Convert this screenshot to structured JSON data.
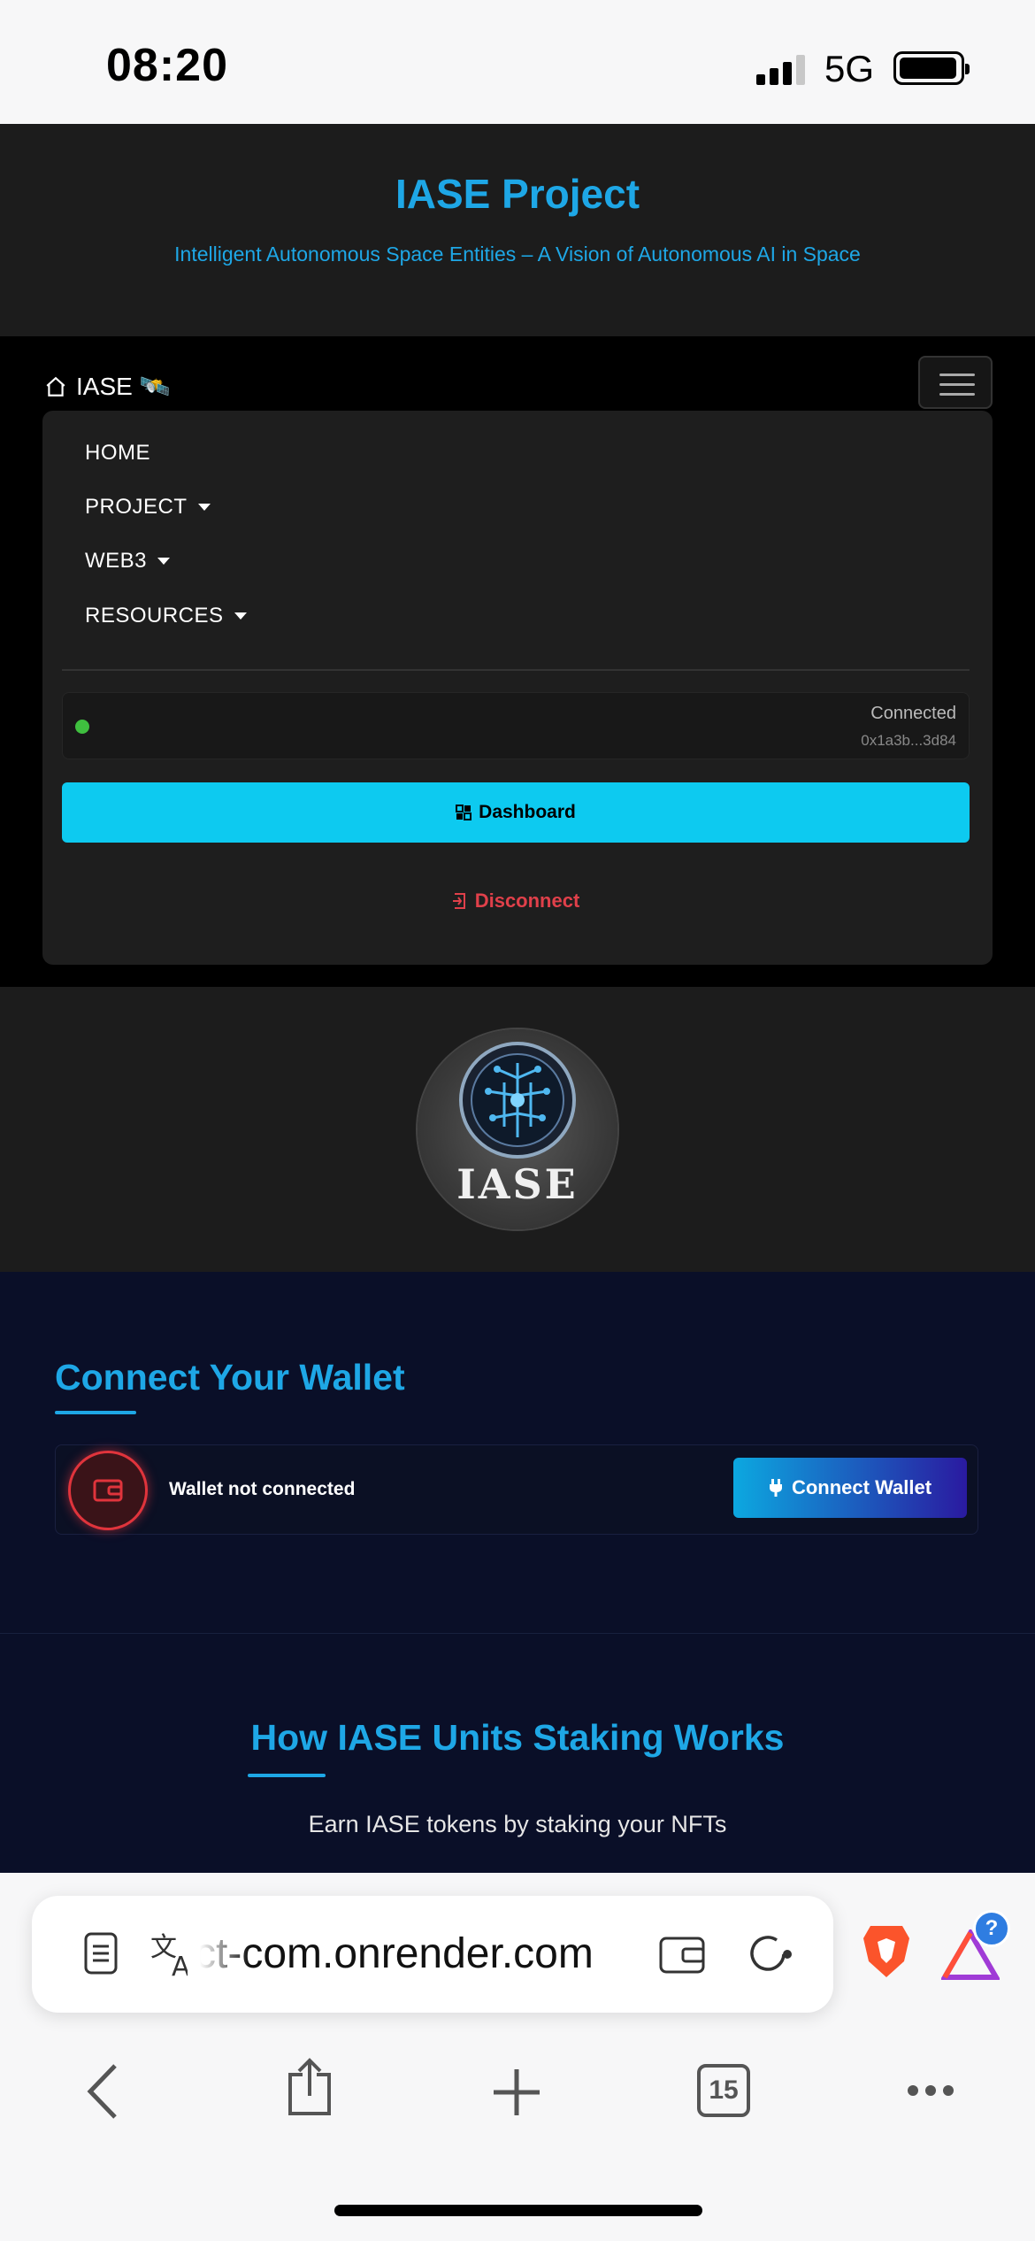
{
  "status_bar": {
    "time": "08:20",
    "network": "5G"
  },
  "header": {
    "title": "IASE Project",
    "subtitle": "Intelligent Autonomous Space Entities – A Vision of Autonomous AI in Space"
  },
  "navbar": {
    "brand": "IASE 🛰️",
    "items": [
      {
        "label": "HOME",
        "dropdown": false
      },
      {
        "label": "PROJECT",
        "dropdown": true
      },
      {
        "label": "WEB3",
        "dropdown": true
      },
      {
        "label": "RESOURCES",
        "dropdown": true
      }
    ],
    "connection": {
      "status": "Connected",
      "address": "0x1a3b...3d84"
    },
    "dashboard_label": "Dashboard",
    "disconnect_label": "Disconnect"
  },
  "logo": {
    "text": "IASE"
  },
  "wallet": {
    "heading": "Connect Your Wallet",
    "status": "Wallet not connected",
    "button": "Connect Wallet"
  },
  "staking": {
    "heading": "How IASE Units Staking Works",
    "subtitle": "Earn IASE tokens by staking your NFTs"
  },
  "browser": {
    "url": "ct-com.onrender.com",
    "tab_count": "15",
    "notification_badge": "?"
  },
  "colors": {
    "accent": "#1ea7e6",
    "dashboard": "#0dcaf0",
    "danger": "#e0404a",
    "connected": "#3fbf3f"
  }
}
